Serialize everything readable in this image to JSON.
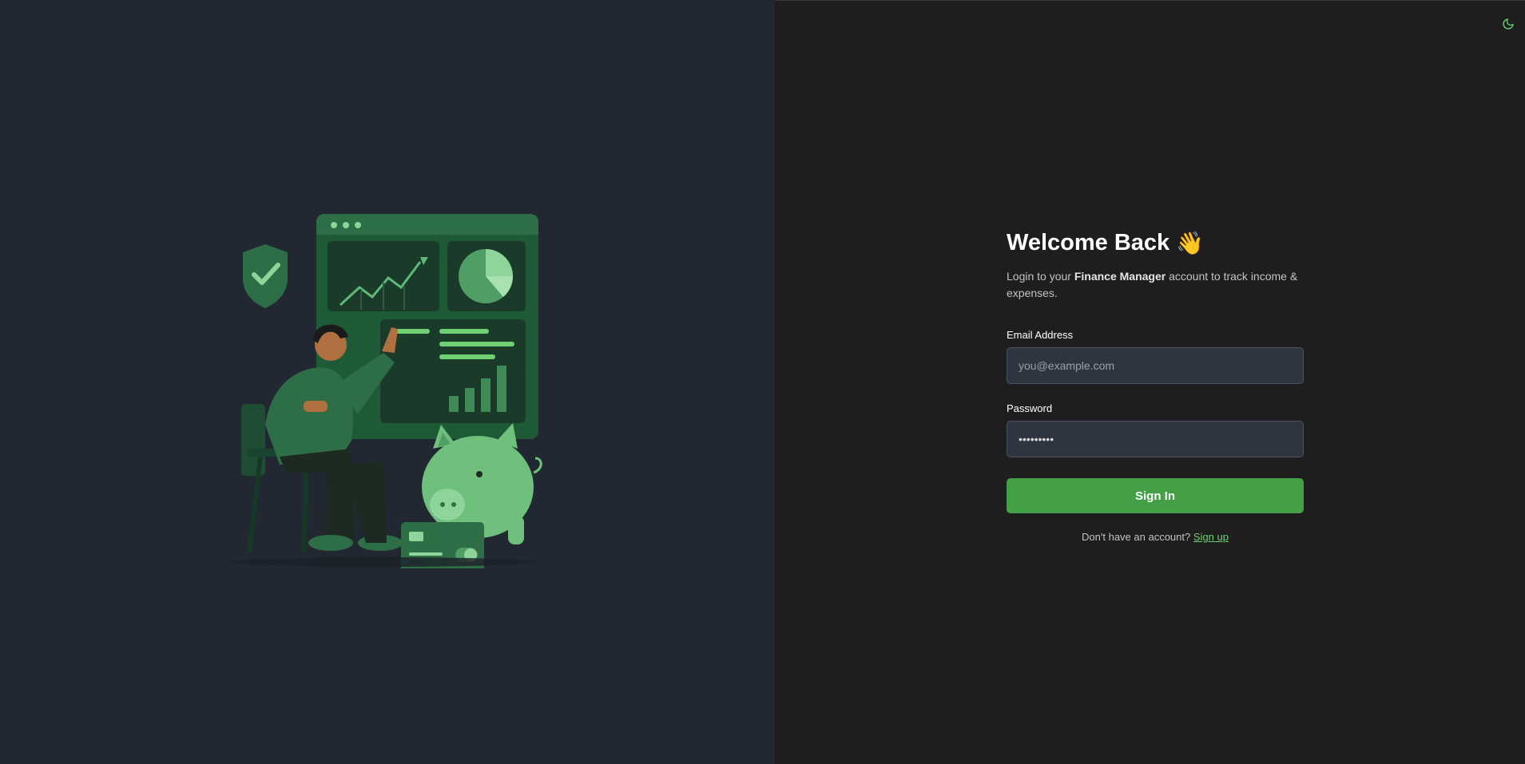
{
  "theme": {
    "toggle_icon": "moon-icon",
    "accent": "#43a047",
    "link_color": "#6fcf73",
    "left_bg": "#222831",
    "right_bg": "#1e1e1e"
  },
  "illustration": {
    "description_icon": "finance-illustration"
  },
  "login": {
    "title": "Welcome Back",
    "title_emoji": "👋",
    "subtitle_prefix": "Login to your ",
    "subtitle_brand": "Finance Manager",
    "subtitle_suffix": " account to track income & expenses.",
    "email_label": "Email Address",
    "email_placeholder": "you@example.com",
    "email_value": "",
    "password_label": "Password",
    "password_value": "password1",
    "signin_label": "Sign In",
    "signup_prompt": "Don't have an account? ",
    "signup_link": "Sign up"
  }
}
